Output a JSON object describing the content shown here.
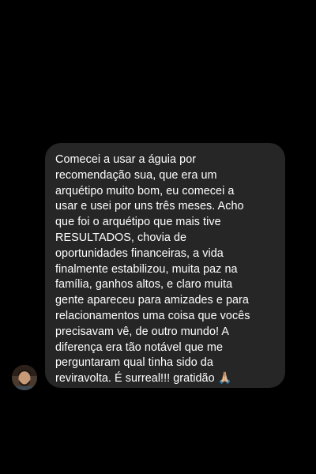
{
  "theme": {
    "background": "#000000",
    "bubble_color": "#262626",
    "text_color": "#ffffff"
  },
  "message": {
    "sender_avatar_icon": "user-avatar-photo",
    "text": "Comecei a usar a águia por\nrecomendação sua, que era um\narquétipo muito bom, eu comecei a\nusar e usei por uns três meses. Acho\nque foi o arquétipo que mais tive\nRESULTADOS, chovia de\noportunidades financeiras, a vida\nfinalmente estabilizou, muita paz na\nfamília, ganhos altos, e claro muita\ngente apareceu para amizades e para\nrelacionamentos uma coisa que vocês\nprecisavam vê, de outro mundo! A\ndiferença era tão notável que me\nperguntaram qual tinha sido da\nreviravolta. É surreal!!! gratidão 🙏🏼"
  }
}
